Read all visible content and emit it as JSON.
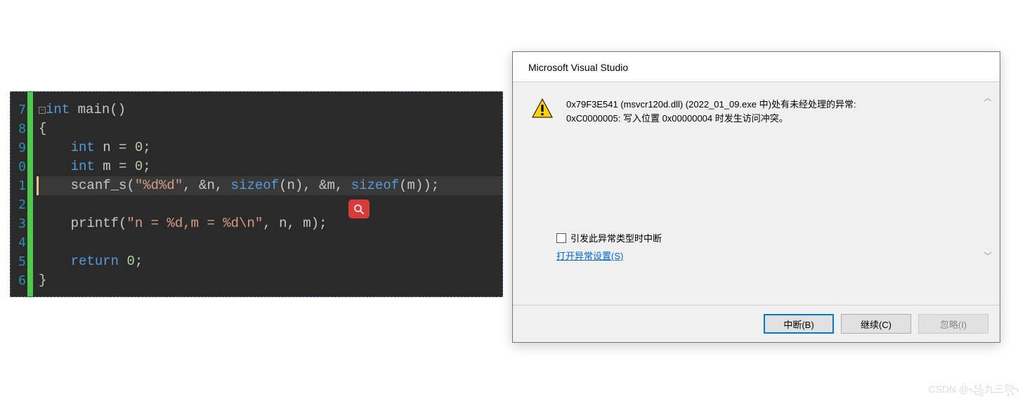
{
  "code": {
    "lines": [
      {
        "n": "7",
        "pre": "",
        "html": "<span class='collapse-box'>−</span><span class='kw'>int</span> <span class='fn'>main</span>()"
      },
      {
        "n": "8",
        "pre": "",
        "html": "{"
      },
      {
        "n": "9",
        "pre": "    ",
        "html": "<span class='kw'>int</span> n = <span class='num'>0</span>;"
      },
      {
        "n": "0",
        "pre": "    ",
        "html": "<span class='kw'>int</span> m = <span class='num'>0</span>;"
      },
      {
        "n": "1",
        "pre": "    ",
        "html": "scanf_s(<span class='str'>\"%d%d\"</span>, &n, <span class='op'>sizeof</span>(n), &m, <span class='op'>sizeof</span>(m));",
        "current": true
      },
      {
        "n": "2",
        "pre": "",
        "html": ""
      },
      {
        "n": "3",
        "pre": "    ",
        "html": "printf(<span class='str'>\"n = %d,m = %d\\n\"</span>, n, m);"
      },
      {
        "n": "4",
        "pre": "",
        "html": ""
      },
      {
        "n": "5",
        "pre": "    ",
        "html": "<span class='kw'>return</span> <span class='num'>0</span>;"
      },
      {
        "n": "6",
        "pre": "",
        "html": "}"
      }
    ]
  },
  "dialog": {
    "title": "Microsoft Visual Studio",
    "message_line1": "0x79F3E541 (msvcr120d.dll) (2022_01_09.exe 中)处有未经处理的异常:",
    "message_line2": "0xC0000005: 写入位置 0x00000004 时发生访问冲突。",
    "checkbox_label": "引发此异常类型时中断",
    "link_label": "打开异常设置(S)",
    "buttons": {
      "break": "中断(B)",
      "continue": "继续(C)",
      "ignore": "忽略(I)"
    }
  },
  "watermark": "CSDN @꧁九三꧂"
}
